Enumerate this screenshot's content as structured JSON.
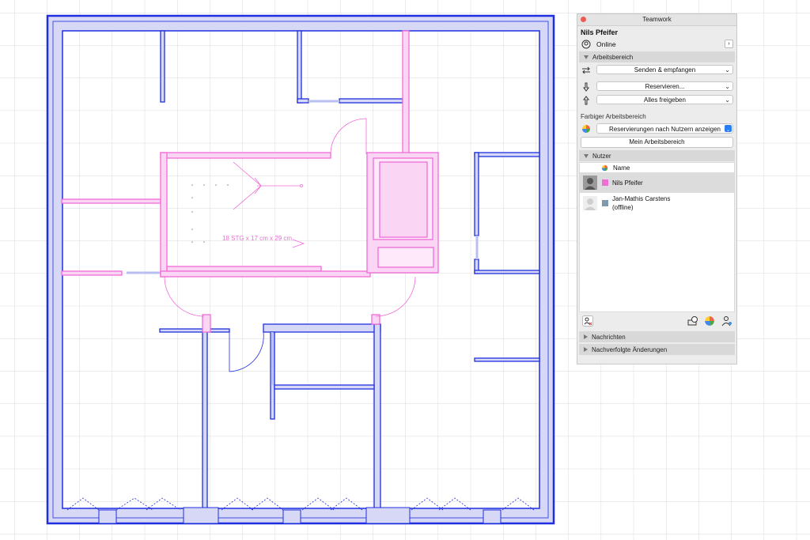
{
  "panel": {
    "title": "Teamwork",
    "user_name": "Nils Pfeifer",
    "status": "Online",
    "sections": {
      "workspace": "Arbeitsbereich",
      "users": "Nutzer",
      "messages": "Nachrichten",
      "changes": "Nachverfolgte Änderungen"
    },
    "buttons": {
      "send_receive": "Senden & empfangen",
      "reserve": "Reservieren...",
      "release_all": "Alles freigeben",
      "my_workspace": "Mein Arbeitsbereich"
    },
    "colored_workspace_label": "Farbiger Arbeitsbereich",
    "color_mode_select": "Reservierungen nach Nutzern anzeigen",
    "user_list": {
      "column_name": "Name",
      "users": [
        {
          "name": "Nils Pfeifer",
          "color": "#f06cd8",
          "selected": true
        },
        {
          "name": "Jan-Mathis Carstens",
          "status": "(offline)",
          "color": "#7f9aaa",
          "selected": false
        }
      ]
    }
  },
  "plan": {
    "stair_label": "18 STG x 17 cm x 29 cm"
  },
  "colors": {
    "wall_blue": "#1f2fe0",
    "wall_fill": "#d6d8f5",
    "reserved_magenta": "#f06cd8",
    "grid": "#d9d9d9"
  }
}
